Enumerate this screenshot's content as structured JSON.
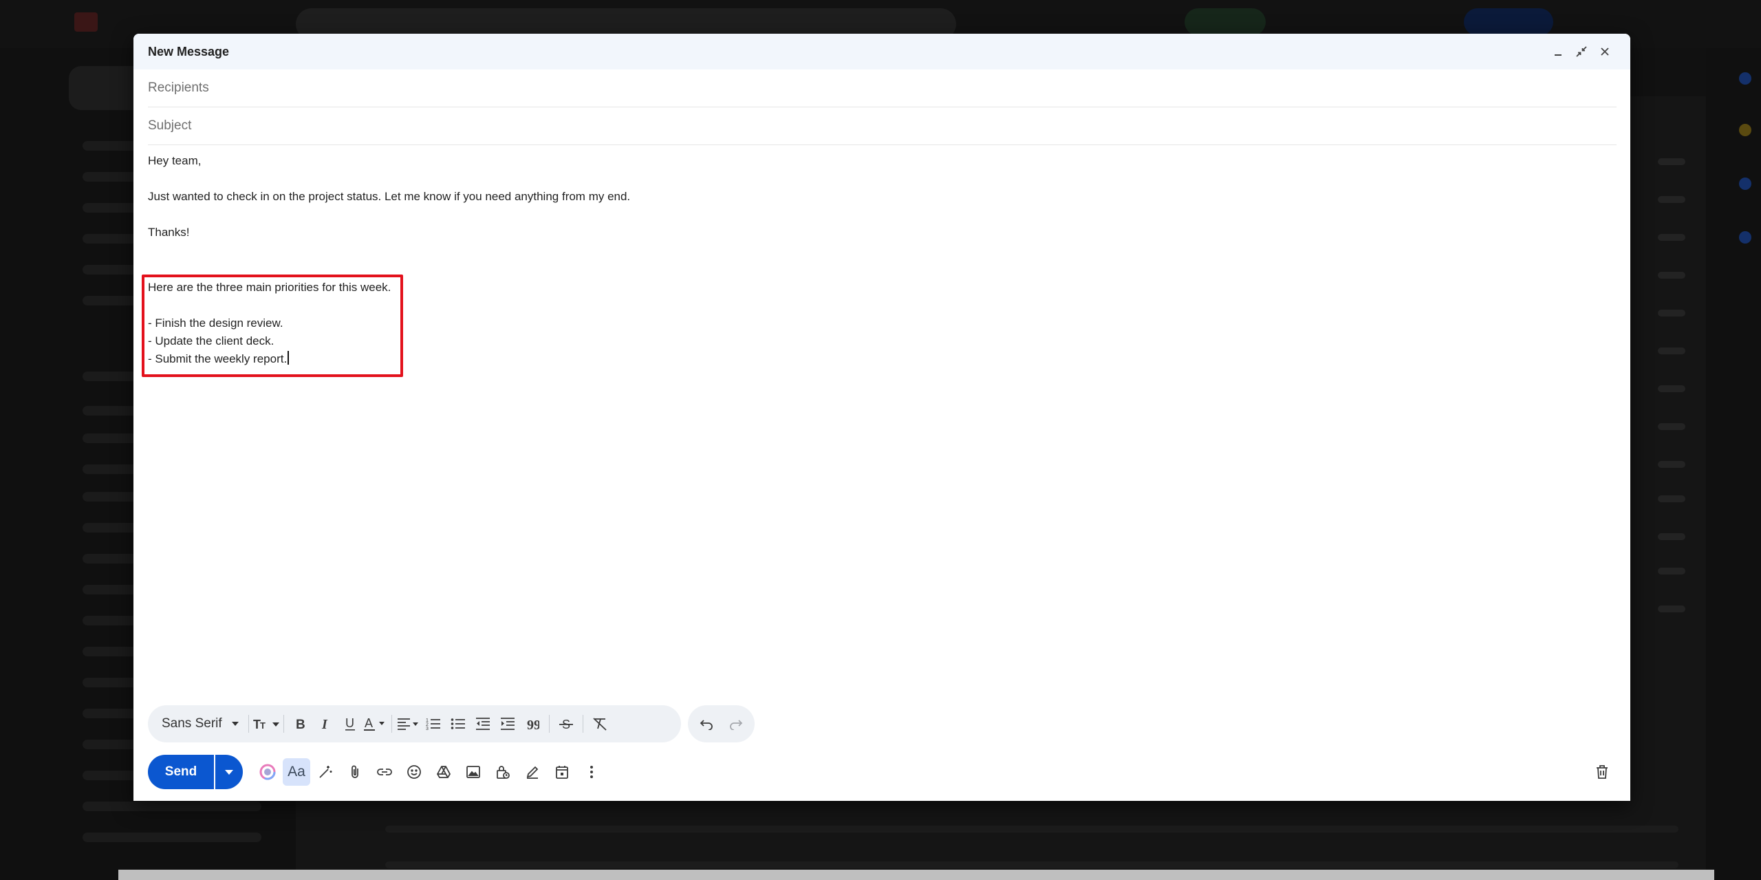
{
  "compose": {
    "title": "New Message",
    "recipients_placeholder": "Recipients",
    "subject_placeholder": "Subject",
    "body_lines": [
      "Hey team,",
      "Just wanted to check in on the project status. Let me know if you need anything from my end.",
      "Thanks!"
    ],
    "highlighted_lines": [
      "Here are the three main priorities for this week.",
      "- Finish the design review.",
      "- Update the client deck.",
      "- Submit the weekly report."
    ],
    "highlight_color": "#e3111c"
  },
  "toolbar": {
    "font": "Sans Serif"
  },
  "actions": {
    "send_label": "Send",
    "text_format_label": "Aa",
    "send_color": "#0b57d0"
  }
}
